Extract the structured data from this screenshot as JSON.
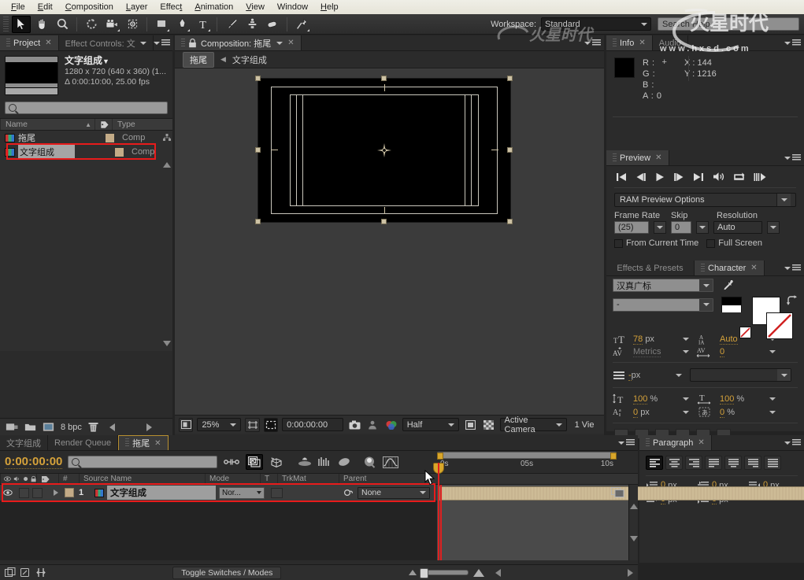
{
  "menu": {
    "items": [
      "File",
      "Edit",
      "Composition",
      "Layer",
      "Effect",
      "Animation",
      "View",
      "Window",
      "Help"
    ]
  },
  "toolbar": {
    "tools": [
      "selection-tool",
      "hand-tool",
      "zoom-tool",
      "rotation-tool",
      "camera-tool",
      "pan-behind-tool",
      "shape-tool",
      "pen-tool",
      "type-tool",
      "brush-tool",
      "clone-stamp-tool",
      "eraser-tool",
      "puppet-pin-tool"
    ],
    "workspace_label": "Workspace:",
    "workspace_value": "Standard",
    "search_help_placeholder": "Search Help"
  },
  "project": {
    "tabs": [
      {
        "label": "Project",
        "active": true,
        "closable": true
      },
      {
        "label": "Effect Controls: 文",
        "active": false,
        "closable": false
      }
    ],
    "selected_item": {
      "name": "文字组成",
      "dimensions": "1280 x 720  (640 x 360) (1...",
      "duration": "Δ 0:00:10:00, 25.00 fps"
    },
    "search_placeholder": "",
    "columns": [
      "Name",
      "Type"
    ],
    "items": [
      {
        "name": "拖尾",
        "type": "Comp",
        "selected": false
      },
      {
        "name": "文字组成",
        "type": "Comp",
        "selected": true
      }
    ],
    "footer": {
      "bit_depth": "8 bpc"
    }
  },
  "composition": {
    "tab_label": "Composition: 拖尾",
    "breadcrumb_current": "拖尾",
    "breadcrumb_next": "文字组成",
    "footer": {
      "zoom": "25%",
      "time": "0:00:00:00",
      "resolution": "Half",
      "camera": "Active Camera",
      "views": "1 Vie"
    }
  },
  "info": {
    "tabs": [
      {
        "label": "Info",
        "active": true
      },
      {
        "label": "Audio",
        "active": false
      }
    ],
    "channels": [
      {
        "label": "R :",
        "value": ""
      },
      {
        "label": "G :",
        "value": ""
      },
      {
        "label": "B :",
        "value": ""
      },
      {
        "label": "A :",
        "value": "0"
      }
    ],
    "x_label": "X : 144",
    "y_label": "Y : 1216"
  },
  "preview": {
    "tab_label": "Preview",
    "transport": [
      "first-frame-icon",
      "previous-frame-icon",
      "play-icon",
      "next-frame-icon",
      "last-frame-icon",
      "audio-icon",
      "loop-icon",
      "ram-preview-icon"
    ],
    "ram_preview_options": "RAM Preview Options",
    "labels": {
      "frame_rate": "Frame Rate",
      "skip": "Skip",
      "resolution": "Resolution"
    },
    "values": {
      "frame_rate": "(25)",
      "skip": "0",
      "resolution": "Auto"
    },
    "checkboxes": [
      {
        "label": "From Current Time",
        "checked": false
      },
      {
        "label": "Full Screen",
        "checked": false
      }
    ]
  },
  "character": {
    "tabs": [
      {
        "label": "Effects & Presets",
        "active": false
      },
      {
        "label": "Character",
        "active": true
      }
    ],
    "font_family": "汉真广标",
    "font_style": "-",
    "font_size": "78",
    "font_size_unit": "px",
    "leading": "Auto",
    "kerning": "Metrics",
    "tracking": "0",
    "stroke_width": "-",
    "stroke_width_unit": "px",
    "stroke_style": "",
    "vertical_scale": "100",
    "horizontal_scale": "100",
    "baseline_shift": "0",
    "baseline_unit": "px",
    "tsume": "0",
    "tsume_unit": "%",
    "percent": "%"
  },
  "paragraph": {
    "tab_label": "Paragraph",
    "alignments": [
      "align-left",
      "align-center",
      "align-right",
      "justify-last-left",
      "justify-last-center",
      "justify-last-right",
      "justify-all"
    ],
    "selected_alignment": 0,
    "indents": [
      {
        "name": "indent-left",
        "value": "0",
        "unit": "px"
      },
      {
        "name": "indent-first-line",
        "value": "0",
        "unit": "px"
      },
      {
        "name": "indent-right",
        "value": "0",
        "unit": "px"
      },
      {
        "name": "space-before",
        "value": "0",
        "unit": "px"
      },
      {
        "name": "space-after",
        "value": "0",
        "unit": "px"
      }
    ]
  },
  "timeline": {
    "tabs": [
      {
        "label": "文字组成",
        "active": false
      },
      {
        "label": "Render Queue",
        "active": false
      },
      {
        "label": "拖尾",
        "active": true
      }
    ],
    "current_time": "0:00:00:00",
    "search_placeholder": "",
    "columns": [
      "#",
      "Source Name",
      "Mode",
      "T",
      "TrkMat",
      "Parent"
    ],
    "layers": [
      {
        "index": "1",
        "source_name": "文字组成",
        "mode": "Nor...",
        "trkmat": "",
        "parent": "None",
        "visible": true,
        "selected": true
      }
    ],
    "ruler_ticks": [
      "0s",
      "05s",
      "10s"
    ],
    "footer_button": "Toggle Switches / Modes"
  },
  "watermark": {
    "url": "www.hxsd.com"
  },
  "colors": {
    "accent_orange": "#d4a13a",
    "panel_bg": "#2b2b2b",
    "selection_red": "#e81b1b",
    "cti_red": "#e02020",
    "layer_bar": "#cdbb96"
  }
}
